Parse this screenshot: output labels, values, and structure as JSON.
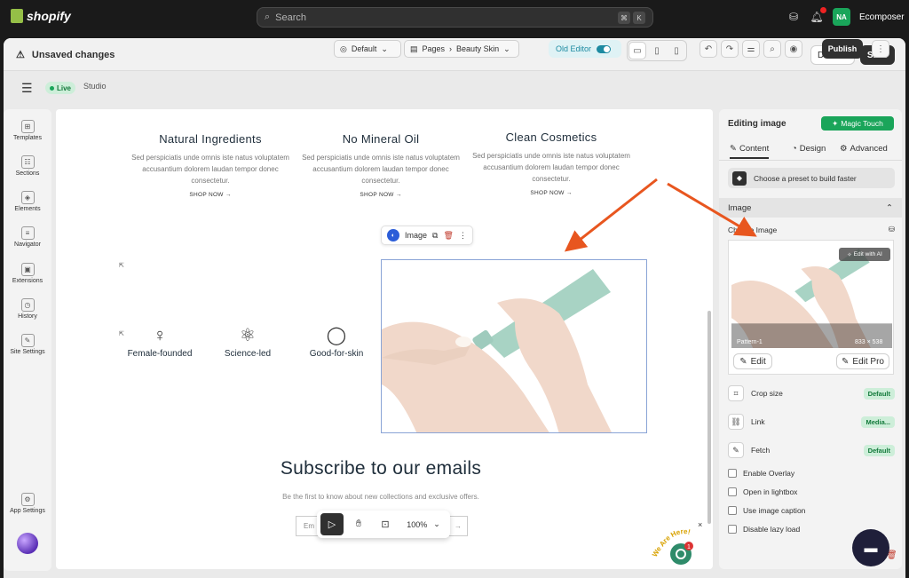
{
  "topbar": {
    "brand": "shopify",
    "search_placeholder": "Search",
    "shortcut_keys": [
      "⌘",
      "K"
    ],
    "notification_count": "",
    "account_initials": "NA",
    "account_name": "Ecomposer"
  },
  "unsaved_bar": {
    "message": "Unsaved changes",
    "discard_label": "Discard",
    "save_label": "Save"
  },
  "editor_toolbar": {
    "live_label": "Live",
    "studio_label": "Studio",
    "layout_select": "Default",
    "pages_label": "Pages",
    "page_name": "Beauty Skin",
    "old_editor_label": "Old Editor",
    "publish_label": "Publish"
  },
  "left_rail": [
    {
      "label": "Templates",
      "icon": "templates-icon"
    },
    {
      "label": "Sections",
      "icon": "sections-icon"
    },
    {
      "label": "Elements",
      "icon": "elements-icon"
    },
    {
      "label": "Navigator",
      "icon": "navigator-icon"
    },
    {
      "label": "Extensions",
      "icon": "extensions-icon"
    },
    {
      "label": "History",
      "icon": "history-icon"
    },
    {
      "label": "Site Settings",
      "icon": "site-settings-icon"
    },
    {
      "label": "App Settings",
      "icon": "app-settings-icon"
    }
  ],
  "canvas": {
    "features": [
      {
        "title": "Natural Ingredients",
        "text": "Sed perspiciatis unde omnis iste natus  voluptatem accusantium dolorem laudan tempor donec consectetur.",
        "link": "SHOP NOW →"
      },
      {
        "title": "No Mineral Oil",
        "text": "Sed perspiciatis unde omnis iste natus  voluptatem accusantium dolorem laudan tempor donec consectetur.",
        "link": "SHOP NOW →"
      },
      {
        "title": "Clean Cosmetics",
        "text": "Sed perspiciatis unde omnis iste natus  voluptatem accusantium dolorem laudan tempor donec consectetur.",
        "link": "SHOP NOW →"
      }
    ],
    "icon_features": [
      {
        "label": "Female-founded",
        "icon": "female-icon"
      },
      {
        "label": "Science-led",
        "icon": "atom-icon"
      },
      {
        "label": "Good-for-skin",
        "icon": "check-circle-icon"
      }
    ],
    "image_toolbar_label": "Image",
    "subscribe_title": "Subscribe to our emails",
    "subscribe_text": "Be the first to know about new collections and exclusive offers.",
    "email_placeholder": "Em",
    "zoom": "100%"
  },
  "panel": {
    "title": "Editing image",
    "magic_touch": "Magic Touch",
    "tabs": [
      "Content",
      "Design",
      "Advanced"
    ],
    "preset_label": "Choose a preset to build faster",
    "section_label": "Image",
    "choose_image_label": "Choose Image",
    "edit_with_ai": "Edit with AI",
    "image_name": "Pattern-1",
    "image_size": "833 × 538",
    "edit_label": "Edit",
    "edit_pro_label": "Edit Pro",
    "properties": [
      {
        "label": "Crop size",
        "value": "Default",
        "icon": "crop-icon"
      },
      {
        "label": "Link",
        "value": "Media...",
        "icon": "link-icon"
      },
      {
        "label": "Fetch",
        "value": "Default",
        "icon": "pencil-icon"
      }
    ],
    "checkboxes": [
      "Enable Overlay",
      "Open in lightbox",
      "Use image caption",
      "Disable lazy load"
    ]
  },
  "help_widget": {
    "text": "We Are Here!",
    "badge": "1"
  }
}
